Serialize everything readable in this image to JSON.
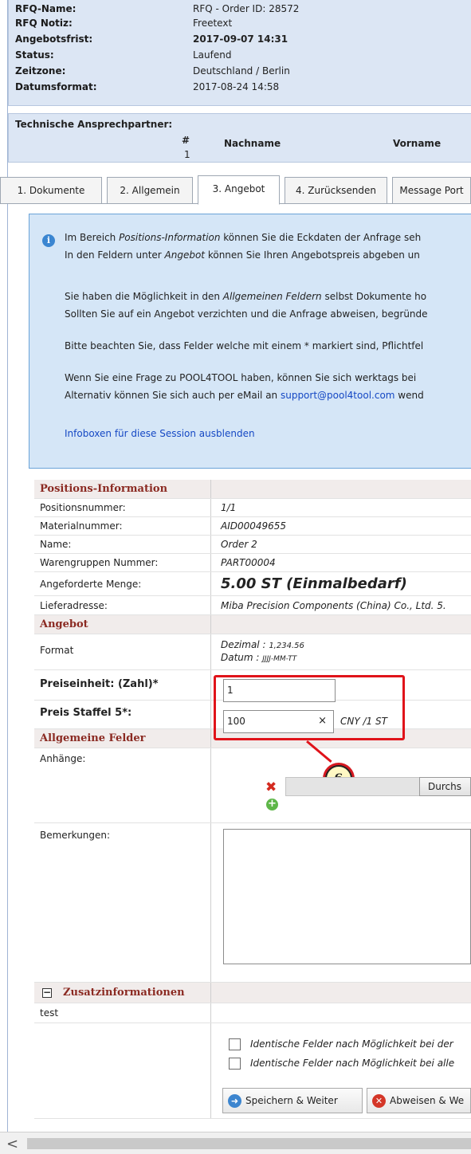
{
  "header": {
    "rows": [
      {
        "key": "RFQ-Name:",
        "value": "RFQ - Order ID: 28572"
      },
      {
        "key": "RFQ Notiz:",
        "value": "Freetext"
      },
      {
        "key": "Angebotsfrist:",
        "value": "2017-09-07 14:31"
      },
      {
        "key": "Status:",
        "value": "Laufend"
      },
      {
        "key": "Zeitzone:",
        "value": "Deutschland / Berlin"
      },
      {
        "key": "Datumsformat:",
        "value": "2017-08-24 14:58"
      }
    ]
  },
  "contacts": {
    "title": "Technische Ansprechpartner:",
    "col_hash": "#",
    "col_nachname": "Nachname",
    "col_vorname": "Vorname",
    "row_number": "1"
  },
  "tabs": [
    {
      "label": "1. Dokumente"
    },
    {
      "label": "2. Allgemein"
    },
    {
      "label": "3. Angebot"
    },
    {
      "label": "4. Zurücksenden"
    },
    {
      "label": "Message Port"
    }
  ],
  "infobox": {
    "line1a": "Im Bereich ",
    "line1b": "Positions-Information",
    "line1c": " können Sie die Eckdaten der Anfrage seh",
    "line2a": "In den Feldern unter ",
    "line2b": "Angebot",
    "line2c": " können Sie Ihren Angebotspreis abgeben un",
    "line3a": "Sie haben die Möglichkeit in den ",
    "line3b": "Allgemeinen Feldern",
    "line3c": " selbst Dokumente ho",
    "line4": "Sollten Sie auf ein Angebot verzichten und die Anfrage abweisen, begründe",
    "line5": "Bitte beachten Sie, dass Felder welche mit einem * markiert sind, Pflichtfel",
    "line6": "Wenn Sie eine Frage zu POOL4TOOL haben, können Sie sich werktags bei",
    "line7a": "Alternativ können Sie sich auch per eMail an ",
    "line7b": "support@pool4tool.com",
    "line7c": " wend",
    "hide_link": "Infoboxen für diese Session ausblenden"
  },
  "positions": {
    "section_title": "Positions-Information",
    "rows": [
      {
        "label": "Positionsnummer:",
        "value": "1/1"
      },
      {
        "label": "Materialnummer:",
        "value": "AID00049655"
      },
      {
        "label": "Name:",
        "value": "Order 2"
      },
      {
        "label": "Warengruppen Nummer:",
        "value": "PART00004"
      },
      {
        "label": "Angeforderte Menge:",
        "value": "5.00 ST (Einmalbedarf)"
      },
      {
        "label": "Lieferadresse:",
        "value": "Miba Precision Components (China) Co., Ltd. 5."
      }
    ]
  },
  "angebot": {
    "section_title": "Angebot",
    "format_label": "Format",
    "format_decimal_label": "Dezimal : ",
    "format_decimal_value": "1,234.56",
    "format_date_label": "Datum : ",
    "format_date_value": "JJJJ-MM-TT",
    "unit_label": "Preiseinheit: (Zahl)*",
    "unit_value": "1",
    "price_label": "Preis Staffel 5*:",
    "price_value": "100",
    "price_clear": "×",
    "price_suffix": "CNY /1 ST"
  },
  "callout": {
    "number": "6"
  },
  "general": {
    "section_title": "Allgemeine Felder",
    "attachments_label": "Anhänge:",
    "browse_label": "Durchs",
    "remarks_label": "Bemerkungen:"
  },
  "extra": {
    "toggle": "−",
    "section_title": "Zusatzinformationen",
    "value": "test"
  },
  "options": {
    "cb1": "Identische Felder nach Möglichkeit bei der",
    "cb2": "Identische Felder nach Möglichkeit bei alle"
  },
  "buttons": {
    "save": "Speichern & Weiter",
    "reject": "Abweisen & We"
  },
  "colors": {
    "header_bg": "#dce6f4",
    "section_text": "#8b2a22",
    "highlight": "#e0131a",
    "link": "#1548c4"
  }
}
